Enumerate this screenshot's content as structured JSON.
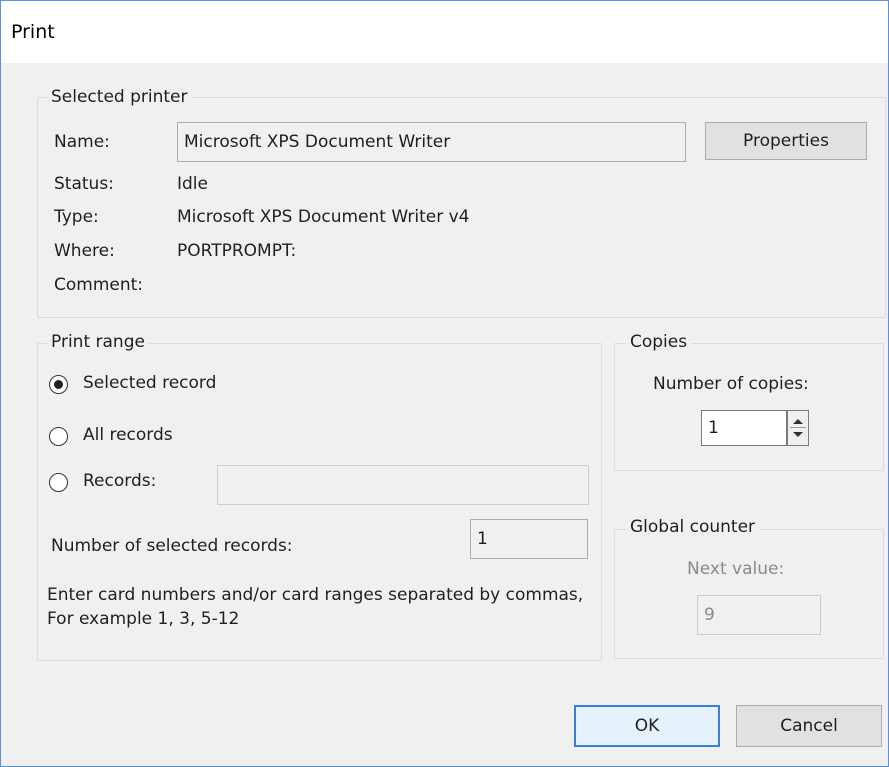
{
  "window": {
    "title": "Print"
  },
  "selected_printer": {
    "legend": "Selected printer",
    "name_label": "Name:",
    "name_value": "Microsoft XPS Document Writer",
    "properties_label": "Properties",
    "status_label": "Status:",
    "status_value": "Idle",
    "type_label": "Type:",
    "type_value": "Microsoft XPS Document Writer v4",
    "where_label": "Where:",
    "where_value": "PORTPROMPT:",
    "comment_label": "Comment:"
  },
  "print_range": {
    "legend": "Print range",
    "options": [
      {
        "label": "Selected record",
        "selected": true
      },
      {
        "label": "All records",
        "selected": false
      },
      {
        "label": "Records:",
        "selected": false
      }
    ],
    "records_value": "",
    "num_selected_label": "Number of selected records:",
    "num_selected_value": "1",
    "hint": "Enter card numbers and/or card ranges separated by commas, For example 1, 3, 5-12"
  },
  "copies": {
    "legend": "Copies",
    "number_label": "Number of copies:",
    "number_value": "1"
  },
  "global_counter": {
    "legend": "Global counter",
    "next_label": "Next value:",
    "next_value": "9"
  },
  "buttons": {
    "ok": "OK",
    "cancel": "Cancel"
  }
}
